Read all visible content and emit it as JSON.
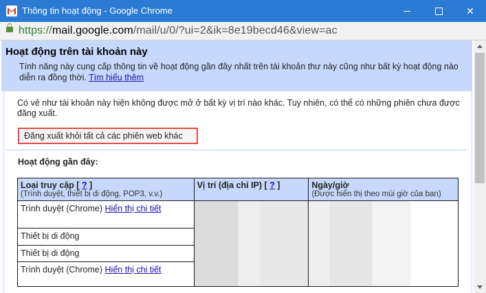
{
  "window": {
    "title": "Thông tin hoạt động - Google Chrome",
    "app_icon": "gmail-icon"
  },
  "address_bar": {
    "scheme": "https://",
    "host": "mail.google.com",
    "path": "/mail/u/0/?ui=2&ik=8e19becd46&view=ac"
  },
  "header": {
    "title": "Hoạt động trên tài khoản này",
    "description": "Tính năng này cung cấp thông tin về hoạt động gần đây nhất trên tài khoản thư này cũng như bất kỳ hoạt động nào diễn ra đồng thời.",
    "learn_more": "Tìm hiểu thêm"
  },
  "status_text": "Có vẻ như tài khoản này hiện không được mở ở bất kỳ vị trí nào khác. Tuy nhiên, có thể có những phiên chưa được đăng xuất.",
  "signout_button": "Đăng xuất khỏi tất cả các phiên web khác",
  "recent_heading": "Hoạt động gần đây:",
  "table": {
    "columns": [
      {
        "label": "Loại truy cập [",
        "help": "?",
        "close": "]",
        "sub": "(Trình duyệt, thiết bị di động, POP3, v.v.)"
      },
      {
        "label": "Vị trí (địa chỉ IP) [",
        "help": "?",
        "close": "]",
        "sub": ""
      },
      {
        "label": "Ngày/giờ",
        "help": "",
        "close": "",
        "sub": "(Được hiển thị theo múi giờ của ban)"
      }
    ],
    "rows": [
      {
        "access": "Trình duyệt (Chrome)",
        "link": "Hiển thị chi tiết"
      },
      {
        "access": "Thiết bị di động",
        "link": ""
      },
      {
        "access": "Thiết bị di động",
        "link": ""
      },
      {
        "access": "Trình duyệt (Chrome)",
        "link": "Hiển thị chi tiết"
      }
    ]
  }
}
